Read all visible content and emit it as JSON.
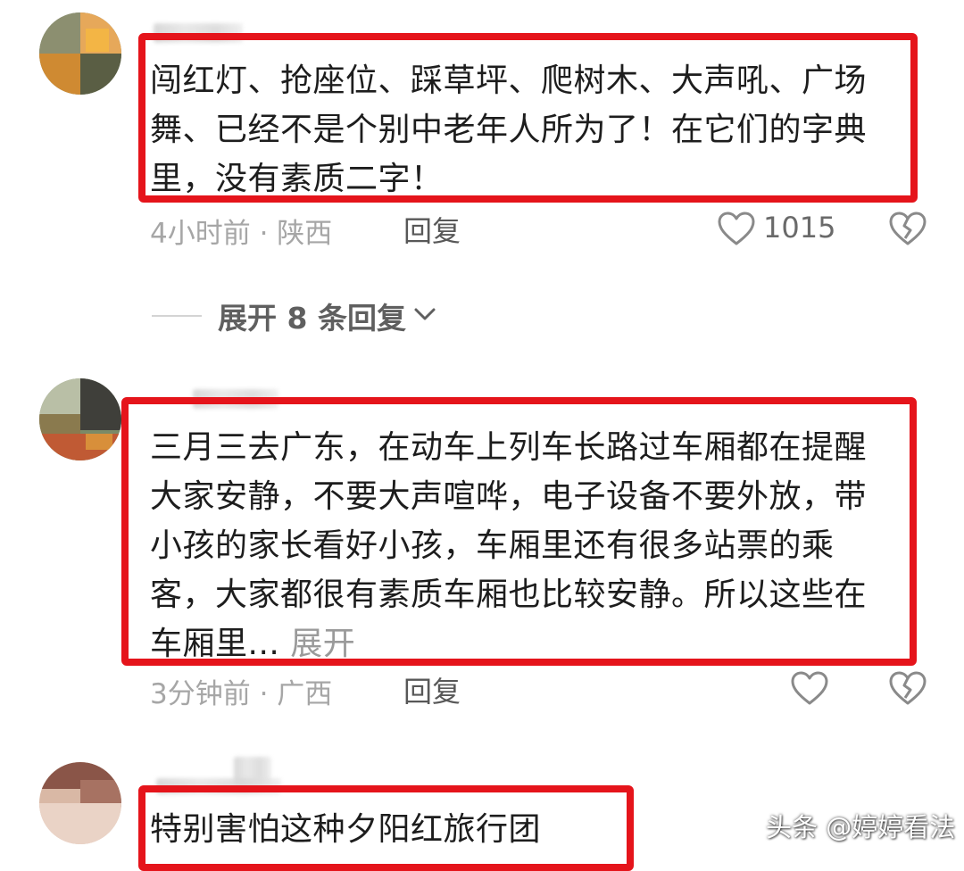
{
  "comments": [
    {
      "text": "闯红灯、抢座位、踩草坪、爬树木、大声吼、广场舞、已经不是个别中老年人所为了！在它们的字典里，没有素质二字！",
      "time_location": "4小时前 · 陕西",
      "reply_label": "回复",
      "like_count": "1015"
    },
    {
      "text": "三月三去广东，在动车上列车长路过车厢都在提醒大家安静，不要大声喧哗，电子设备不要外放，带小孩的家长看好小孩，车厢里还有很多站票的乘客，大家都很有素质车厢也比较安静。所以这些在车厢里...",
      "expand_label": "展开",
      "time_location": "3分钟前 · 广西",
      "reply_label": "回复"
    },
    {
      "text": "特别害怕这种夕阳红旅行团"
    }
  ],
  "replies_toggle": {
    "label": "展开 8 条回复"
  },
  "watermark": "头条 @婷婷看法",
  "icons": {
    "like": "heart-icon",
    "dislike": "broken-heart-icon",
    "expand": "chevron-down-icon"
  },
  "colors": {
    "highlight_border": "#e5141b",
    "meta_text": "#a6a6a6"
  }
}
